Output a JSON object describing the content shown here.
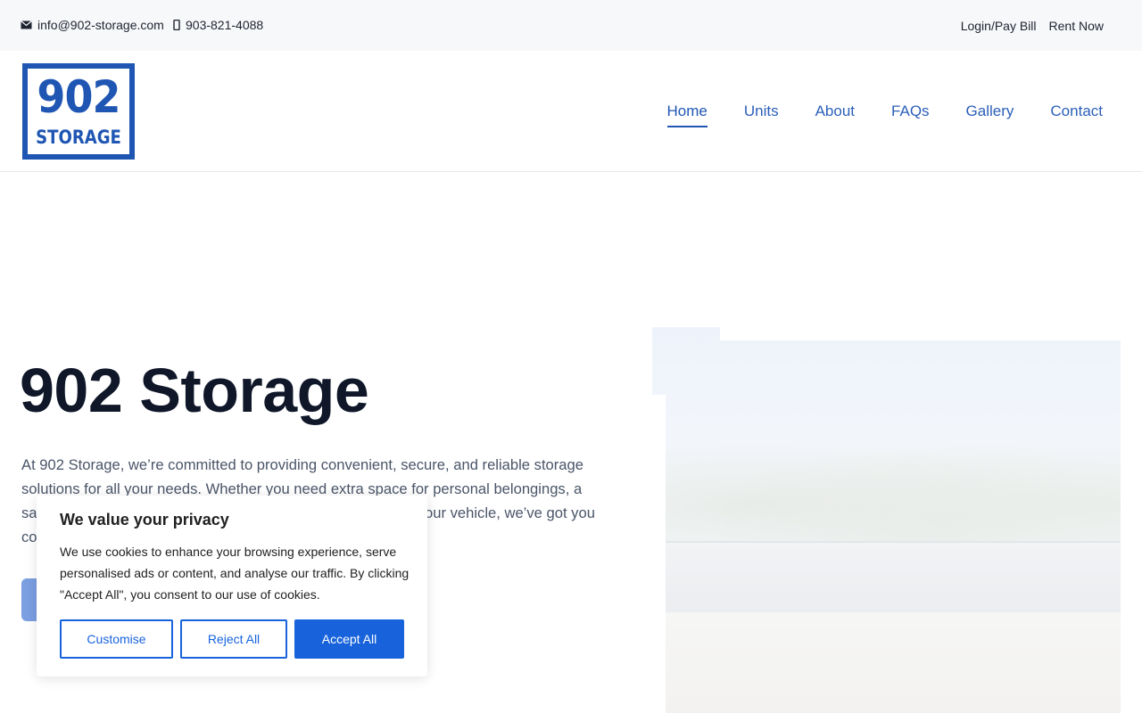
{
  "topbar": {
    "email": "info@902-storage.com",
    "phone": "903-821-4088",
    "login_label": "Login/Pay Bill",
    "rent_label": "Rent Now"
  },
  "logo": {
    "number": "902",
    "word": "STORAGE"
  },
  "nav": {
    "items": [
      {
        "label": "Home",
        "active": true
      },
      {
        "label": "Units"
      },
      {
        "label": "About"
      },
      {
        "label": "FAQs"
      },
      {
        "label": "Gallery"
      },
      {
        "label": "Contact"
      }
    ]
  },
  "hero": {
    "title": "902 Storage",
    "line1": "At 902 Storage, we’re committed to providing convenient, secure, and reliable storage",
    "line2": "solutions for all your needs. Whether you need extra space for personal belongings, a",
    "line3_left": "sa",
    "line3_right": "our vehicle, we’ve got you",
    "line4": "co"
  },
  "cookie": {
    "title": "We value your privacy",
    "text": "We use cookies to enhance your browsing experience, serve personalised ads or content, and analyse our traffic. By clicking \"Accept All\", you consent to our use of cookies.",
    "customise_label": "Customise",
    "reject_label": "Reject All",
    "accept_label": "Accept All"
  },
  "colors": {
    "brand": "#1f56b3",
    "accent": "#1863dc",
    "title": "#0f1729"
  }
}
